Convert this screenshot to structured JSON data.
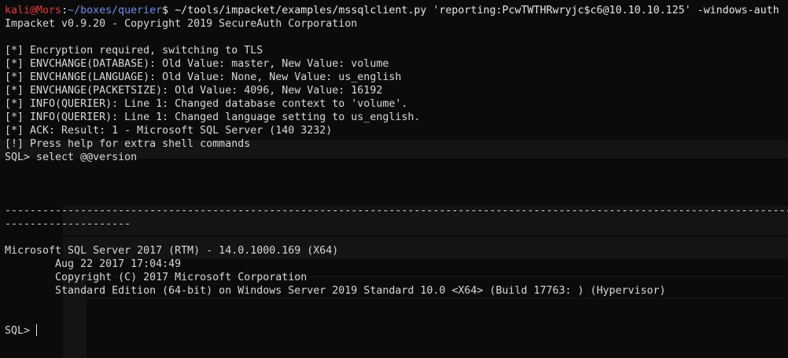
{
  "prompt": {
    "user_host": "kali@Mors",
    "separator": ":",
    "path": "~/boxes/querier",
    "symbol": "$ ",
    "command": "~/tools/impacket/examples/mssqlclient.py 'reporting:PcwTWTHRwryjc$c6@10.10.10.125' -windows-auth"
  },
  "output": {
    "banner": "Impacket v0.9.20 - Copyright 2019 SecureAuth Corporation",
    "messages": [
      "[*] Encryption required, switching to TLS",
      "[*] ENVCHANGE(DATABASE): Old Value: master, New Value: volume",
      "[*] ENVCHANGE(LANGUAGE): Old Value: None, New Value: us_english",
      "[*] ENVCHANGE(PACKETSIZE): Old Value: 4096, New Value: 16192",
      "[*] INFO(QUERIER): Line 1: Changed database context to 'volume'.",
      "[*] INFO(QUERIER): Line 1: Changed language setting to us_english.",
      "[*] ACK: Result: 1 - Microsoft SQL Server (140 3232)",
      "[!] Press help for extra shell commands"
    ],
    "query_line": "SQL> select @@version",
    "dashes_1": "-----------------------------------------------------------------------------------------------------------------------------------------------------",
    "dashes_2": "--------------------",
    "version": [
      "Microsoft SQL Server 2017 (RTM) - 14.0.1000.169 (X64)",
      "        Aug 22 2017 17:04:49",
      "        Copyright (C) 2017 Microsoft Corporation",
      "        Standard Edition (64-bit) on Windows Server 2019 Standard 10.0 <X64> (Build 17763: ) (Hypervisor)"
    ],
    "final_prompt": "SQL> "
  },
  "colors": {
    "background": "#0b0b0b",
    "text": "#d8d8d8",
    "user_host": "#e0383b",
    "path": "#6d8ee6"
  }
}
